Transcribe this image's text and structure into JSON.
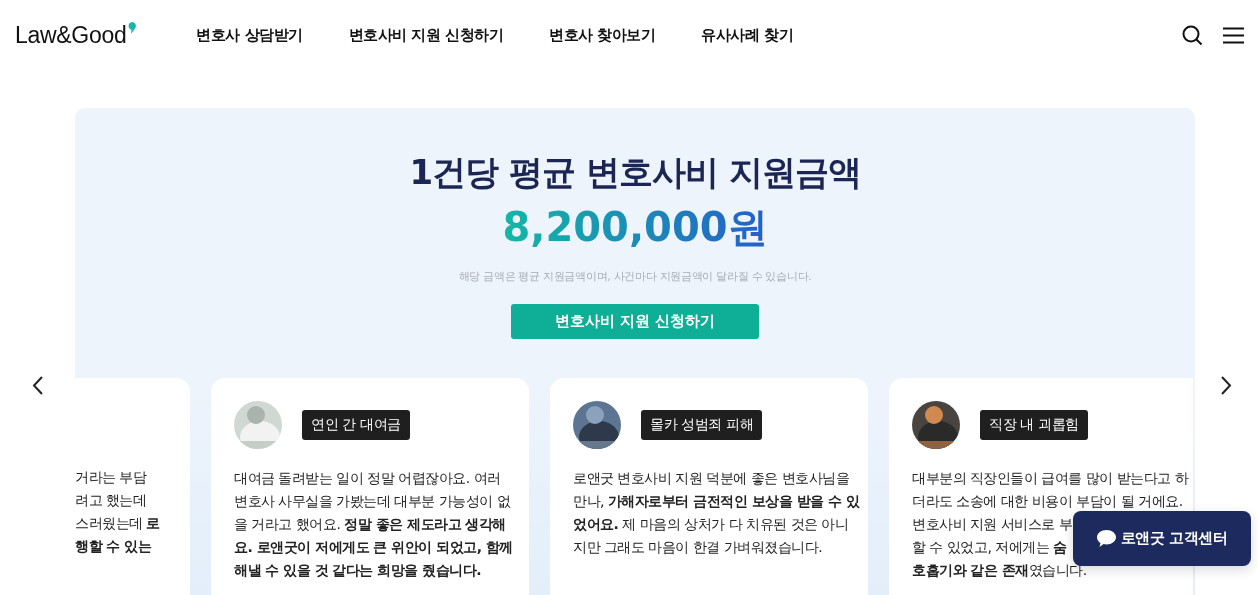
{
  "header": {
    "logo": "Law&Good",
    "nav": [
      "변호사 상담받기",
      "변호사비 지원 신청하기",
      "변호사 찾아보기",
      "유사사례 찾기"
    ]
  },
  "hero": {
    "title": "1건당 평균 변호사비 지원금액",
    "amount": "8,200,000원",
    "note": "해당 금액은 평균 지원금액이며, 사건마다 지원금액이 달라질 수 있습니다.",
    "cta": "변호사비 지원 신청하기"
  },
  "reviews": [
    {
      "kind": "partial",
      "lines": [
        "거라는 부담",
        "려고 했는데",
        "스러웠는데 **로**",
        "**행할 수 있는**"
      ]
    },
    {
      "kind": "full",
      "tag": "연인 간 대여금",
      "lines": [
        "대여금 돌려받는 일이 정말 어렵잖아요. 여러",
        "변호사 사무실을 가봤는데 대부분 가능성이 없",
        "을 거라고 했어요. **정말 좋은 제도라고 생각해**",
        "**요. 로앤굿이 저에게도 큰 위안이 되었고, 함께**",
        "**해낼 수 있을 것 같다는 희망을 줬습니다.**"
      ]
    },
    {
      "kind": "full",
      "tag": "몰카 성범죄 피해",
      "lines": [
        "로앤굿 변호사비 지원 덕분에 좋은 변호사님을",
        "만나, **가해자로부터 금전적인 보상을 받을 수 있**",
        "**었어요.** 제 마음의 상처가 다 치유된 것은 아니",
        "지만 그래도 마음이 한결 가벼워졌습니다."
      ]
    },
    {
      "kind": "full",
      "tag": "직장 내 괴롭힘",
      "lines": [
        "대부분의 직장인들이 급여를 많이 받는다고 하",
        "더라도 소송에 대한 비용이 부담이 될 거에요.",
        "변호사비 지원 서비스로 부",
        "할 수 있었고, 저에게는 **숨**",
        "**호흡기와 같은 존재**였습니다."
      ]
    }
  ],
  "support_button": "로앤굿 고객센터"
}
